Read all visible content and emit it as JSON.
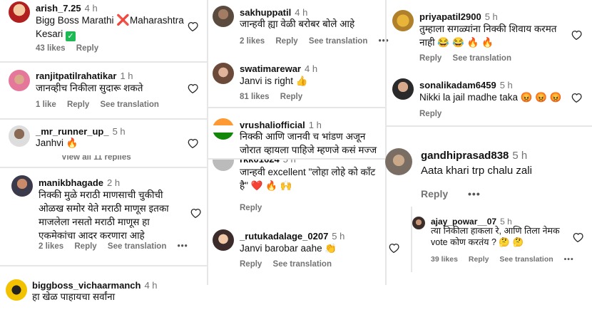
{
  "col1": {
    "c1": {
      "user": "arish_7.25",
      "time": "4 h",
      "text_a": "Bigg Boss Marathi",
      "text_b": "Maharashtra",
      "text_c": "Kesari",
      "cross": "❌",
      "check": "✅",
      "likes": "43 likes",
      "reply": "Reply"
    },
    "c2": {
      "user": "ranjitpatilrahatikar",
      "time": "1 h",
      "text": "जानव्हीच निकीला सुदारू शकते",
      "likes": "1 like",
      "reply": "Reply",
      "see": "See translation"
    },
    "c3": {
      "user": "_mr_runner_up_",
      "time": "5 h",
      "text": "Janhvi 🔥",
      "view": "View all 11 replies"
    },
    "c4": {
      "user": "manikbhagade",
      "time": "2 h",
      "text1": "निक्की मुळे मराठी माणसाची चुकीची",
      "text2": "ओळख समोर येते मराठी माणूस इतका",
      "text3": "माजलेला नसतो मराठी माणूस हा",
      "text4": "एकमेकांचा आदर करणारा आहे",
      "likes": "2 likes",
      "reply": "Reply",
      "see": "See translation",
      "dots": "•••"
    },
    "c5": {
      "user": "biggboss_vichaarmanch",
      "time": "4 h",
      "text": "हा खेळ पाहायचा सर्वांना"
    }
  },
  "col2": {
    "c1": {
      "user": "sakhuppatil",
      "time": "4 h",
      "text": "जान्हवी ह्या वेळी बरोबर बोले आहे",
      "likes": "2 likes",
      "reply": "Reply",
      "see": "See translation",
      "dots": "•••"
    },
    "c2": {
      "user": "swatimarewar",
      "time": "4 h",
      "text": "Janvi is right 👍",
      "likes": "81 likes",
      "reply": "Reply"
    },
    "c3": {
      "user": "vrushaliofficial",
      "time": "1 h",
      "text1": "निक्की आणि जानवी च भांडण अजून",
      "text2": "जोरात व्हायला पाहिजे म्हणजे कसं मज्ज"
    },
    "c4": {
      "user": "rkk01624",
      "time": "5 h",
      "text1": "जान्हवी excellent \"लोहा लोहे को काँट",
      "text2": "है\" ❤️ 🔥 🙌",
      "reply": "Reply"
    },
    "c5": {
      "user": "_rutukadalage_0207",
      "time": "5 h",
      "text": "Janvi barobar aahe 👏",
      "reply": "Reply",
      "see": "See translation"
    }
  },
  "col3": {
    "c1": {
      "user": "priyapatil2900",
      "time": "5 h",
      "text1": "तुम्हाला सगळ्यांना निक्की शिवाय करमत",
      "text2": "नाही 😂 😂 🔥 🔥",
      "reply": "Reply",
      "see": "See translation"
    },
    "c2": {
      "user": "sonalikadam6459",
      "time": "5 h",
      "text": "Nikki la jail madhe taka 😡 😡 😡",
      "reply": "Reply"
    },
    "c3": {
      "user": "gandhiprasad838",
      "time": "5 h",
      "text": "Aata khari trp chalu zali",
      "reply": "Reply",
      "dots": "•••"
    },
    "c4": {
      "user": "ajay_powar__07",
      "time": "5 h",
      "text1": "त्या निकीला हाकला रे, आणि तिला नेमक",
      "text2": "vote कोण करतंय ? 🤔 🤔",
      "likes": "39 likes",
      "reply": "Reply",
      "see": "See translation",
      "dots": "•••"
    }
  },
  "colors": {
    "meta": "#737373",
    "link": "#00376b",
    "heart": "#262626"
  }
}
